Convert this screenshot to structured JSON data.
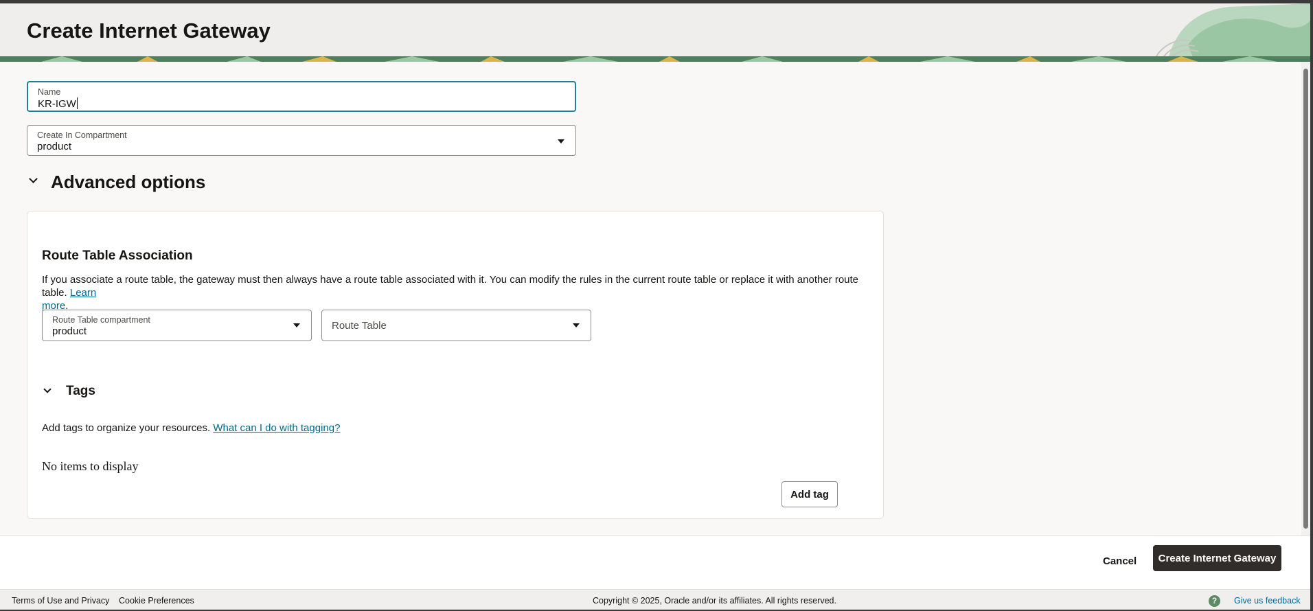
{
  "page": {
    "title": "Create Internet Gateway"
  },
  "form": {
    "name": {
      "label": "Name",
      "value": "KR-IGW"
    },
    "compartment": {
      "label": "Create In Compartment",
      "value": "product"
    }
  },
  "advanced": {
    "title": "Advanced options"
  },
  "route_table": {
    "heading": "Route Table Association",
    "description": "If you associate a route table, the gateway must then always have a route table associated with it. You can modify the rules in the current route table or replace it with another route table.",
    "learn_more_1": "Learn",
    "learn_more_2": "more",
    "period": ".",
    "compartment_label": "Route Table compartment",
    "compartment_value": "product",
    "table_placeholder": "Route Table"
  },
  "tags": {
    "heading": "Tags",
    "description": "Add tags to organize your resources.",
    "help_link": "What can I do with tagging?",
    "empty": "No items to display",
    "add_label": "Add tag"
  },
  "actions": {
    "cancel": "Cancel",
    "create": "Create Internet Gateway"
  },
  "footer": {
    "terms": "Terms of Use and Privacy",
    "cookies": "Cookie Preferences",
    "copyright": "Copyright © 2025, Oracle and/or its affiliates. All rights reserved.",
    "help_glyph": "?",
    "feedback": "Give us feedback"
  },
  "colors": {
    "link": "#00688c",
    "primary": "#312d2a",
    "focus": "#227e9e",
    "header_green": "#6ea37a"
  }
}
